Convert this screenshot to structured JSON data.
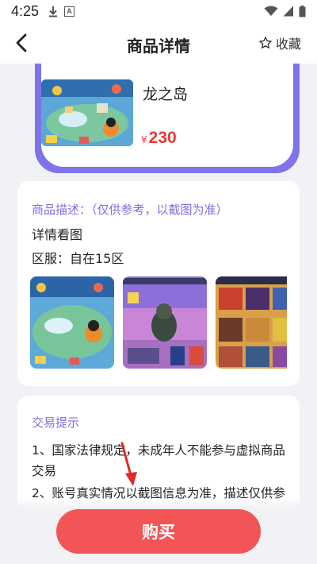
{
  "status_bar": {
    "time": "4:25",
    "icons": [
      "download-icon",
      "a-notification-icon",
      "wifi-icon",
      "signal-icon",
      "battery-icon"
    ]
  },
  "header": {
    "title": "商品详情",
    "favorite_label": "收藏"
  },
  "product": {
    "name": "龙之岛",
    "currency": "¥",
    "price": "230"
  },
  "description": {
    "label": "商品描述：（仅供参考，以截图为准）",
    "detail_title": "详情看图",
    "server": "区服：自在15区"
  },
  "tips": {
    "label": "交易提示",
    "line1a": "1、国家法律规定，未成年人不能参与虚拟商品",
    "line1b": "交易",
    "line2": "2、账号真实情况以截图信息为准，描述仅供参"
  },
  "buy_button": {
    "label": "购买"
  },
  "colors": {
    "accent": "#7b6fe0",
    "card_border": "#7f73e9",
    "price": "#e23a3a",
    "buy": "#f25555"
  }
}
